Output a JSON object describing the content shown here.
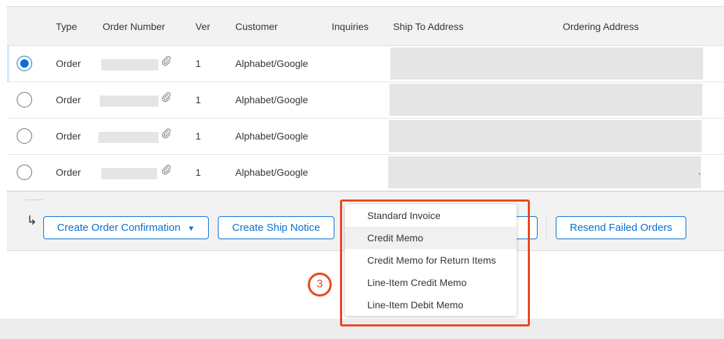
{
  "table": {
    "headers": {
      "type": "Type",
      "order_number": "Order Number",
      "ver": "Ver",
      "customer": "Customer",
      "inquiries": "Inquiries",
      "ship_to": "Ship To Address",
      "ordering_address": "Ordering Address"
    },
    "rows": [
      {
        "selected": true,
        "type": "Order",
        "ver": "1",
        "customer": "Alphabet/Google"
      },
      {
        "selected": false,
        "type": "Order",
        "ver": "1",
        "customer": "Alphabet/Google"
      },
      {
        "selected": false,
        "type": "Order",
        "ver": "1",
        "customer": "Alphabet/Google"
      },
      {
        "selected": false,
        "type": "Order",
        "ver": "1",
        "customer": "Alphabet/Google"
      }
    ],
    "row_trailing_mark": "."
  },
  "actions": {
    "return_arrow": "↳",
    "create_order_confirmation": "Create Order Confirmation",
    "dropdown_caret": "▼",
    "create_ship_notice": "Create Ship Notice",
    "resend_failed_orders": "Resend Failed Orders"
  },
  "invoice_menu": {
    "items": [
      "Standard Invoice",
      "Credit Memo",
      "Credit Memo for Return Items",
      "Line-Item Credit Memo",
      "Line-Item Debit Memo"
    ],
    "hovered_item": "Credit Memo"
  },
  "annotation": {
    "step_number": "3",
    "color": "#e8461f"
  },
  "colors": {
    "accent": "#0a6ed1",
    "header_bg": "#f2f2f2",
    "redaction": "#e5e5e5"
  },
  "icons": {
    "attachment": "paperclip-icon",
    "return_arrow": "return-arrow-icon",
    "dropdown": "chevron-down-icon"
  }
}
